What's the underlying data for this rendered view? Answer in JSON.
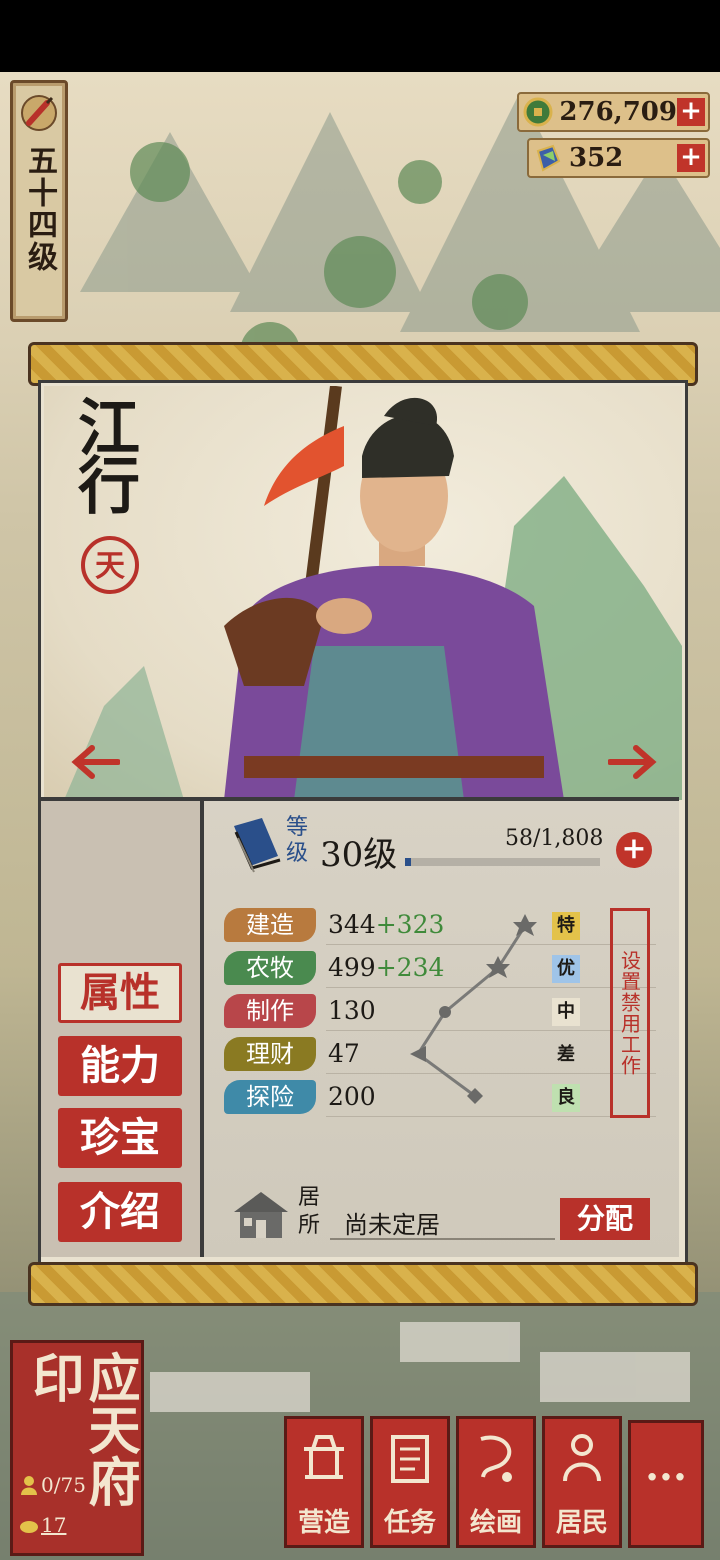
{
  "player": {
    "level_text": "五十四级"
  },
  "currencies": {
    "coins": {
      "value": "276,709",
      "icon": "coin-icon",
      "color": "#3f7a3a"
    },
    "gems": {
      "value": "352",
      "icon": "jade-icon"
    }
  },
  "character": {
    "name": "江行",
    "seal_text": "天",
    "level_label": "等级",
    "level_value": "30级",
    "exp": "58/1,808",
    "exp_progress": 0.032,
    "add_label": "+"
  },
  "tabs": [
    {
      "label": "属性",
      "active": true
    },
    {
      "label": "能力",
      "active": false
    },
    {
      "label": "珍宝",
      "active": false
    },
    {
      "label": "介绍",
      "active": false
    }
  ],
  "attributes": [
    {
      "name": "建造",
      "base": "344",
      "bonus": "+323",
      "grade": "特",
      "color": "#b87a3e",
      "grade_bg": "#e3c24a"
    },
    {
      "name": "农牧",
      "base": "499",
      "bonus": "+234",
      "grade": "优",
      "color": "#4a8a4f",
      "grade_bg": "#9fc4e8"
    },
    {
      "name": "制作",
      "base": "130",
      "bonus": "",
      "grade": "中",
      "color": "#b8464a",
      "grade_bg": "#e9e2d0"
    },
    {
      "name": "理财",
      "base": "47",
      "bonus": "",
      "grade": "差",
      "color": "#8a7a22",
      "grade_bg": ""
    },
    {
      "name": "探险",
      "base": "200",
      "bonus": "",
      "grade": "良",
      "color": "#3f8aa8",
      "grade_bg": "#bfe0b0"
    }
  ],
  "ban_work_label": "设置禁用工作",
  "residence": {
    "label": "居所",
    "value": "尚未定居",
    "assign_label": "分配"
  },
  "city": {
    "name": "应天府印",
    "population": "0/75",
    "count": "17"
  },
  "bottom_menu": [
    {
      "label": "营造",
      "icon": "build-icon"
    },
    {
      "label": "任务",
      "icon": "scroll-icon"
    },
    {
      "label": "绘画",
      "icon": "painting-icon"
    },
    {
      "label": "居民",
      "icon": "resident-icon"
    }
  ],
  "more_label": "···"
}
